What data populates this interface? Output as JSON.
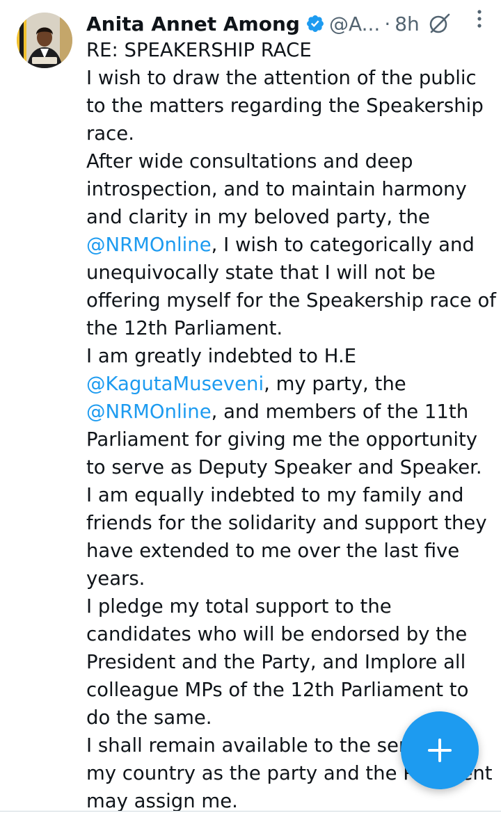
{
  "author": {
    "name": "Anita Annet Among",
    "handle": "@A...",
    "separator": "·",
    "time": "8h"
  },
  "tweet": {
    "title": "RE: SPEAKERSHIP RACE",
    "p1": "I wish to draw the attention of the public to the matters regarding the Speakership race.",
    "p2_before": "After wide consultations and deep introspection, and to maintain harmony and clarity in my beloved party, the ",
    "p2_mention": "@NRMOnline",
    "p2_after": ", I wish to categorically and unequivocally state that I will not be offering myself for the Speakership race of the 12th Parliament.",
    "p3_before": "I am greatly indebted to H.E ",
    "p3_mention1": "@KagutaMuseveni",
    "p3_middle": ", my party, the ",
    "p3_mention2": "@NRMOnline",
    "p3_after": ", and members of the 11th Parliament for giving me the opportunity to serve as Deputy Speaker and Speaker.",
    "p4": "I am equally indebted to my family and friends for the solidarity and support they have extended to me over the last five years.",
    "p5": "I pledge my total support to the candidates who will be endorsed by the President and the Party, and Implore all colleague MPs of the 12th Parliament to do the same.",
    "p6": "I shall remain available to the service of my country as the party and the President may assign me."
  },
  "icons": {
    "verified": "verified-badge-icon",
    "grok": "grok-icon",
    "more": "more-vertical-icon",
    "compose": "plus-icon"
  },
  "colors": {
    "accent": "#1d9bf0",
    "text": "#0f1419",
    "secondary": "#536471"
  }
}
